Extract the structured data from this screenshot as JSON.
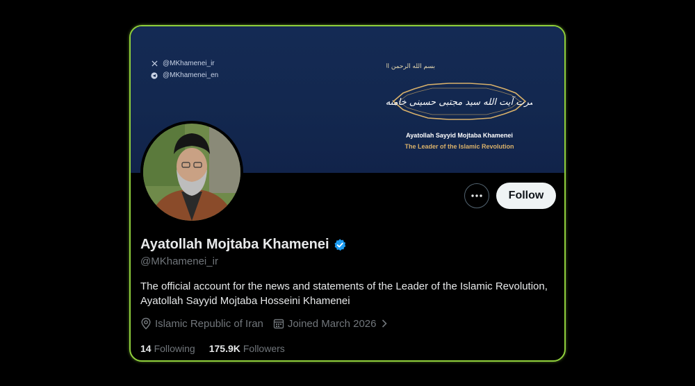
{
  "banner": {
    "social": [
      {
        "icon": "x-logo-icon",
        "handle": "@MKhamenei_ir"
      },
      {
        "icon": "telegram-icon",
        "handle": "@MKhamenei_en"
      }
    ],
    "calligraphy_top": "بسم الله الرحمن الرحیم",
    "calligraphy_main": "حضرت آیت الله سید مجتبی حسینی خامنه‌ای",
    "name": "Ayatollah Sayyid Mojtaba Khamenei",
    "subtitle": "The Leader of the Islamic Revolution",
    "colors": {
      "background": "#13284f",
      "gold": "#d9b16a"
    }
  },
  "profile": {
    "name": "Ayatollah Mojtaba Khamenei",
    "verified": true,
    "handle": "@MKhamenei_ir",
    "bio": "The official account for the news and statements of the Leader of the Islamic Revolution, Ayatollah Sayyid Mojtaba Hosseini Khamenei",
    "location": "Islamic Republic of Iran",
    "joined": "Joined March 2026",
    "following_count": "14",
    "following_label": "Following",
    "followers_count": "175.9K",
    "followers_label": "Followers"
  },
  "actions": {
    "more_icon": "more-horizontal-icon",
    "follow_label": "Follow"
  },
  "colors": {
    "accent_border": "#8fcf3c",
    "verified": "#1d9bf0",
    "muted": "#71767b"
  }
}
